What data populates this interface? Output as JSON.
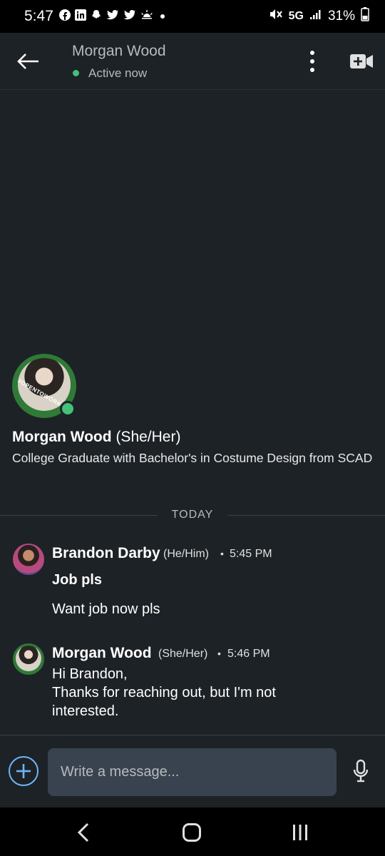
{
  "status_bar": {
    "time": "5:47",
    "network": "5G",
    "battery": "31%",
    "notification_icons": [
      "facebook-icon",
      "linkedin-icon",
      "snapchat-icon",
      "twitter-icon",
      "twitter-icon",
      "weather-icon"
    ]
  },
  "header": {
    "name": "Morgan Wood",
    "status": "Active now"
  },
  "profile": {
    "name": "Morgan Wood",
    "pronouns": "(She/Her)",
    "headline": "College Graduate with Bachelor's in Costume Design from SCAD",
    "badge": "#OPENTOWORK"
  },
  "divider": {
    "label": "TODAY"
  },
  "messages": [
    {
      "sender": "Brandon Darby",
      "pronouns": "(He/Him)",
      "time": "5:45 PM",
      "lines": [
        "Job pls",
        "Want job now pls"
      ]
    },
    {
      "sender": "Morgan Wood",
      "pronouns": "(She/Her)",
      "time": "5:46 PM",
      "lines": [
        "Hi Brandon,",
        "Thanks for reaching out, but I'm not",
        "interested."
      ]
    }
  ],
  "composer": {
    "placeholder": "Write a message..."
  },
  "colors": {
    "background": "#1d2226",
    "accent_blue": "#70b5f9",
    "online_green": "#43c07a",
    "input_bg": "#38434f"
  }
}
